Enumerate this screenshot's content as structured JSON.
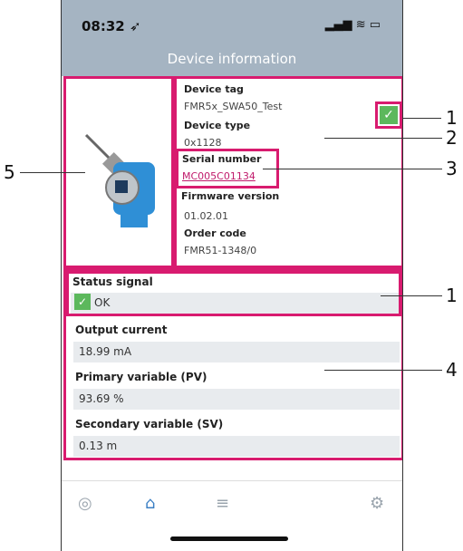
{
  "status_bar": {
    "time": "08:32 ➶",
    "icons": "▂▄▆ ≋ ▭"
  },
  "header": {
    "title": "Device information"
  },
  "device": {
    "tag_label": "Device tag",
    "tag_value": "FMR5x_SWA50_Test",
    "type_label": "Device type",
    "type_value": "0x1128",
    "serial_label": "Serial number",
    "serial_value": "MC005C01134",
    "firmware_label": "Firmware version",
    "firmware_value": "01.02.01",
    "order_label": "Order code",
    "order_value": "FMR51-1348/0"
  },
  "fields": {
    "status_label": "Status signal",
    "status_value": "OK",
    "output_label": "Output current",
    "output_value": "18.99 mA",
    "pv_label": "Primary variable (PV)",
    "pv_value": "93.69 %",
    "sv_label": "Secondary variable (SV)",
    "sv_value": "0.13 m"
  },
  "callouts": {
    "c1a": "1",
    "c2": "2",
    "c3": "3",
    "c1b": "1",
    "c4": "4",
    "c5": "5"
  },
  "colors": {
    "highlight": "#d81b6f",
    "header": "#a5b4c2",
    "ok": "#5cb85c"
  }
}
